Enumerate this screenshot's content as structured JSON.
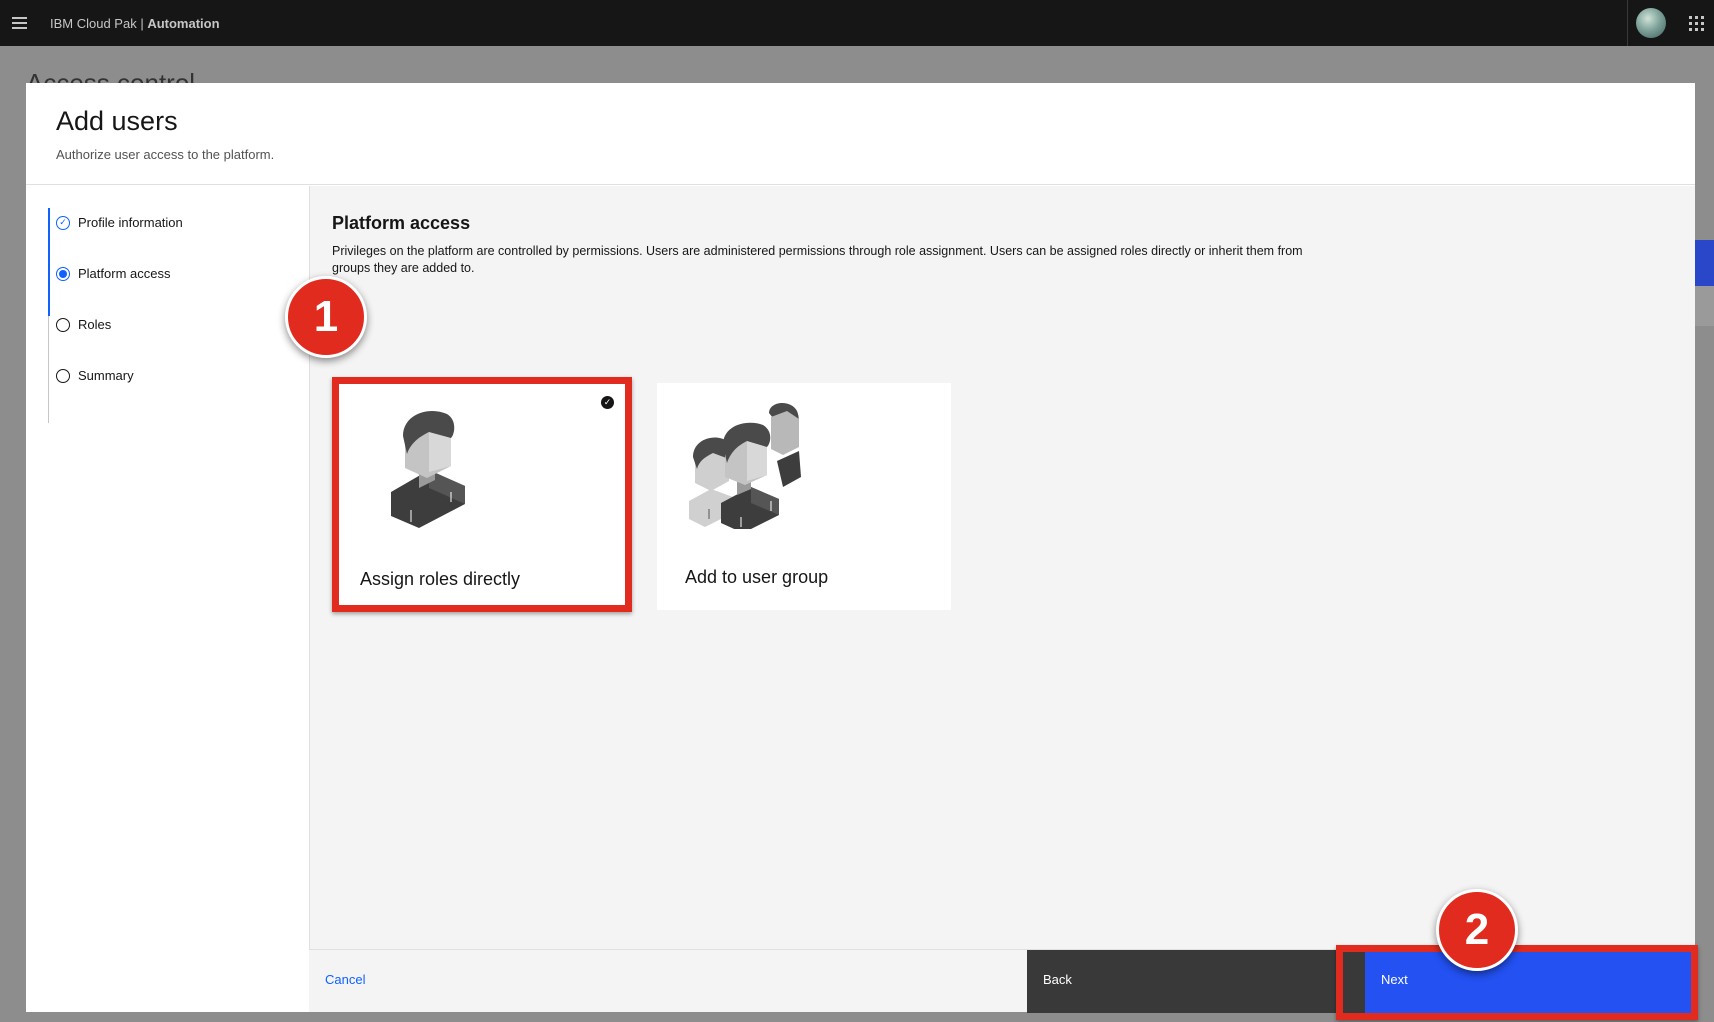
{
  "shell": {
    "brand_prefix": "IBM Cloud Pak | ",
    "brand_product": "Automation"
  },
  "background_page": {
    "title": "Access control"
  },
  "modal": {
    "title": "Add users",
    "subtitle": "Authorize user access to the platform.",
    "steps": [
      {
        "label": "Profile information",
        "state": "complete"
      },
      {
        "label": "Platform access",
        "state": "current"
      },
      {
        "label": "Roles",
        "state": "incomplete"
      },
      {
        "label": "Summary",
        "state": "incomplete"
      }
    ],
    "section": {
      "title": "Platform access",
      "description": "Privileges on the platform are controlled by permissions. Users are administered permissions through role assignment. Users can be assigned roles directly or inherit them from groups they are added to."
    },
    "tiles": [
      {
        "label": "Assign roles directly",
        "selected": true,
        "icon": "single-user-icon"
      },
      {
        "label": "Add to user group",
        "selected": false,
        "icon": "user-group-icon"
      }
    ],
    "footer": {
      "cancel_label": "Cancel",
      "back_label": "Back",
      "next_label": "Next"
    }
  },
  "annotations": {
    "callout_1": "1",
    "callout_2": "2",
    "highlight_color": "#e12b1e"
  },
  "colors": {
    "accent": "#0f62fe",
    "primary_button": "#2351f2",
    "secondary_button": "#393939",
    "header": "#161616"
  }
}
